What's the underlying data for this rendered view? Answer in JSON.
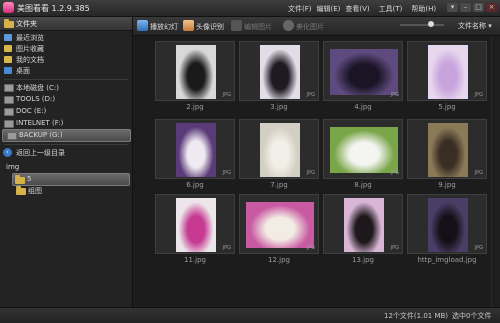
{
  "app": {
    "title": "美图看看 1.2.9.385"
  },
  "menu": [
    "文件(F)",
    "编辑(E)",
    "查看(V)",
    "工具(T)",
    "帮助(H)"
  ],
  "window_buttons": [
    "▾",
    "–",
    "□",
    "×"
  ],
  "sidebar": {
    "header": "文件夹",
    "favorites": [
      "最近浏览",
      "图片收藏",
      "我的文档",
      "桌面"
    ],
    "drives": [
      "本地磁盘 (C:)",
      "TOOLS (D:)",
      "DOC (E:)",
      "INTELNET (F:)",
      "BACKUP (G:)"
    ],
    "up_label": "返回上一级目录",
    "tree": [
      "img",
      "5",
      "组图"
    ]
  },
  "toolbar": {
    "slideshow": "播放幻灯",
    "avatar": "头像识别",
    "edit": "编辑图片",
    "beautify": "美化图片",
    "sort": "文件名称"
  },
  "photos": [
    {
      "name": "2.jpg",
      "bg": "#d8d8d8",
      "fg": "#1a1a1a"
    },
    {
      "name": "3.jpg",
      "bg": "#e2dde6",
      "fg": "#1e1a22"
    },
    {
      "name": "4.jpg",
      "bg": "#5e4a7e",
      "fg": "#1a1424"
    },
    {
      "name": "5.jpg",
      "bg": "#e6d6ee",
      "fg": "#c9a4dc"
    },
    {
      "name": "6.jpg",
      "bg": "#5a3a78",
      "fg": "#efeaf2"
    },
    {
      "name": "7.jpg",
      "bg": "#d4cfc4",
      "fg": "#f2efe8"
    },
    {
      "name": "8.jpg",
      "bg": "#7aa64a",
      "fg": "#f4f4f0"
    },
    {
      "name": "9.jpg",
      "bg": "#8b7a58",
      "fg": "#3a2e24"
    },
    {
      "name": "11.jpg",
      "bg": "#ece6ea",
      "fg": "#c63a92"
    },
    {
      "name": "12.jpg",
      "bg": "#c85aa2",
      "fg": "#f2ece4"
    },
    {
      "name": "13.jpg",
      "bg": "#d9b6d6",
      "fg": "#1e181c"
    },
    {
      "name": "http_imgload.jpg",
      "bg": "#4a3e66",
      "fg": "#141018"
    }
  ],
  "jpg_tag": "JPG",
  "status": {
    "count": "12个文件(1.01 MB)",
    "selected": "选中0个文件"
  }
}
